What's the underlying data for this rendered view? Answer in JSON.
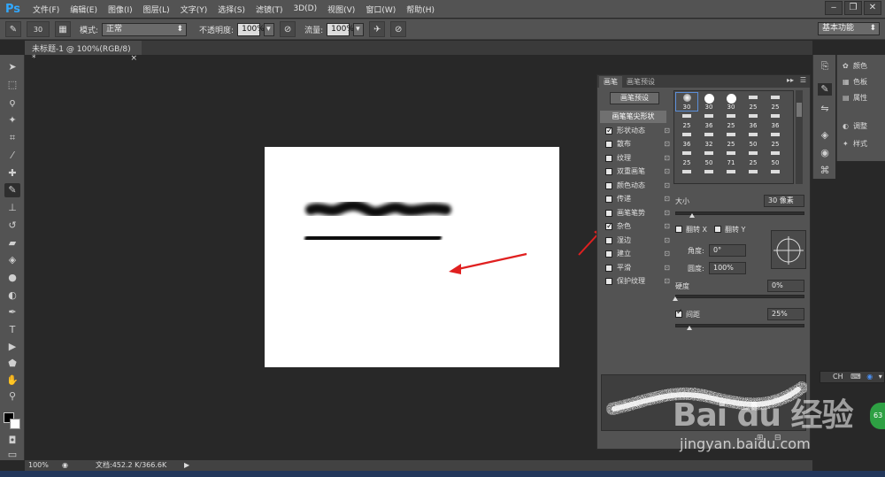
{
  "app": {
    "logo": "Ps"
  },
  "menubar": {
    "items": [
      "文件(F)",
      "编辑(E)",
      "图像(I)",
      "图层(L)",
      "文字(Y)",
      "选择(S)",
      "滤镜(T)",
      "3D(D)",
      "视图(V)",
      "窗口(W)",
      "帮助(H)"
    ]
  },
  "window_controls": {
    "minimize": "‒",
    "restore": "❐",
    "close": "✕"
  },
  "options_bar": {
    "brush_size": "30",
    "mode_label": "模式:",
    "mode_value": "正常",
    "opacity_label": "不透明度:",
    "opacity_value": "100%",
    "flow_label": "流量:",
    "flow_value": "100%",
    "workspace": "基本功能"
  },
  "document_tab": {
    "title": "未标题-1 @ 100%(RGB/8) *",
    "close": "×"
  },
  "brush_panel": {
    "tabs": [
      "画笔",
      "画笔预设"
    ],
    "preset_button": "画笔预设",
    "tip_shape": "画笔笔尖形状",
    "options": [
      {
        "label": "形状动态",
        "checked": true
      },
      {
        "label": "散布",
        "checked": false
      },
      {
        "label": "纹理",
        "checked": false
      },
      {
        "label": "双重画笔",
        "checked": false
      },
      {
        "label": "颜色动态",
        "checked": false
      },
      {
        "label": "传递",
        "checked": false
      },
      {
        "label": "画笔笔势",
        "checked": false
      },
      {
        "label": "杂色",
        "checked": true
      },
      {
        "label": "湿边",
        "checked": false
      },
      {
        "label": "建立",
        "checked": false
      },
      {
        "label": "平滑",
        "checked": false
      },
      {
        "label": "保护纹理",
        "checked": false
      }
    ],
    "tip_sizes": [
      "30",
      "30",
      "30",
      "25",
      "25",
      "25",
      "36",
      "25",
      "36",
      "36",
      "36",
      "32",
      "25",
      "50",
      "25",
      "25",
      "50",
      "71",
      "25",
      "50"
    ],
    "size_label": "大小",
    "size_value": "30 像素",
    "flip_x": "翻转 X",
    "flip_y": "翻转 Y",
    "angle_label": "角度:",
    "angle_value": "0°",
    "roundness_label": "圆度:",
    "roundness_value": "100%",
    "hardness_label": "硬度",
    "hardness_value": "0%",
    "spacing_label": "间距",
    "spacing_value": "25%",
    "spacing_checked": true
  },
  "right_panel": {
    "items": [
      "颜色",
      "色板",
      "属性",
      "调整",
      "样式"
    ]
  },
  "status_bar": {
    "zoom": "100%",
    "doc_info": "文档:452.2 K/366.6K"
  },
  "ime_bar": {
    "label": "CH"
  },
  "watermark": {
    "logo": "Bai du 经验",
    "url": "jingyan.baidu.com"
  },
  "badge": {
    "value": "63"
  }
}
